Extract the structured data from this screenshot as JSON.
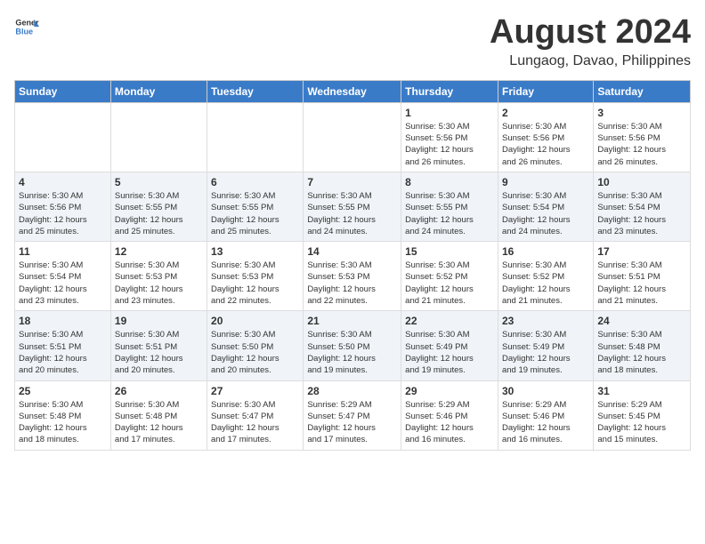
{
  "header": {
    "logo_general": "General",
    "logo_blue": "Blue",
    "title": "August 2024",
    "location": "Lungaog, Davao, Philippines"
  },
  "weekdays": [
    "Sunday",
    "Monday",
    "Tuesday",
    "Wednesday",
    "Thursday",
    "Friday",
    "Saturday"
  ],
  "weeks": [
    {
      "days": [
        {
          "num": "",
          "info": ""
        },
        {
          "num": "",
          "info": ""
        },
        {
          "num": "",
          "info": ""
        },
        {
          "num": "",
          "info": ""
        },
        {
          "num": "1",
          "info": "Sunrise: 5:30 AM\nSunset: 5:56 PM\nDaylight: 12 hours\nand 26 minutes."
        },
        {
          "num": "2",
          "info": "Sunrise: 5:30 AM\nSunset: 5:56 PM\nDaylight: 12 hours\nand 26 minutes."
        },
        {
          "num": "3",
          "info": "Sunrise: 5:30 AM\nSunset: 5:56 PM\nDaylight: 12 hours\nand 26 minutes."
        }
      ]
    },
    {
      "days": [
        {
          "num": "4",
          "info": "Sunrise: 5:30 AM\nSunset: 5:56 PM\nDaylight: 12 hours\nand 25 minutes."
        },
        {
          "num": "5",
          "info": "Sunrise: 5:30 AM\nSunset: 5:55 PM\nDaylight: 12 hours\nand 25 minutes."
        },
        {
          "num": "6",
          "info": "Sunrise: 5:30 AM\nSunset: 5:55 PM\nDaylight: 12 hours\nand 25 minutes."
        },
        {
          "num": "7",
          "info": "Sunrise: 5:30 AM\nSunset: 5:55 PM\nDaylight: 12 hours\nand 24 minutes."
        },
        {
          "num": "8",
          "info": "Sunrise: 5:30 AM\nSunset: 5:55 PM\nDaylight: 12 hours\nand 24 minutes."
        },
        {
          "num": "9",
          "info": "Sunrise: 5:30 AM\nSunset: 5:54 PM\nDaylight: 12 hours\nand 24 minutes."
        },
        {
          "num": "10",
          "info": "Sunrise: 5:30 AM\nSunset: 5:54 PM\nDaylight: 12 hours\nand 23 minutes."
        }
      ]
    },
    {
      "days": [
        {
          "num": "11",
          "info": "Sunrise: 5:30 AM\nSunset: 5:54 PM\nDaylight: 12 hours\nand 23 minutes."
        },
        {
          "num": "12",
          "info": "Sunrise: 5:30 AM\nSunset: 5:53 PM\nDaylight: 12 hours\nand 23 minutes."
        },
        {
          "num": "13",
          "info": "Sunrise: 5:30 AM\nSunset: 5:53 PM\nDaylight: 12 hours\nand 22 minutes."
        },
        {
          "num": "14",
          "info": "Sunrise: 5:30 AM\nSunset: 5:53 PM\nDaylight: 12 hours\nand 22 minutes."
        },
        {
          "num": "15",
          "info": "Sunrise: 5:30 AM\nSunset: 5:52 PM\nDaylight: 12 hours\nand 21 minutes."
        },
        {
          "num": "16",
          "info": "Sunrise: 5:30 AM\nSunset: 5:52 PM\nDaylight: 12 hours\nand 21 minutes."
        },
        {
          "num": "17",
          "info": "Sunrise: 5:30 AM\nSunset: 5:51 PM\nDaylight: 12 hours\nand 21 minutes."
        }
      ]
    },
    {
      "days": [
        {
          "num": "18",
          "info": "Sunrise: 5:30 AM\nSunset: 5:51 PM\nDaylight: 12 hours\nand 20 minutes."
        },
        {
          "num": "19",
          "info": "Sunrise: 5:30 AM\nSunset: 5:51 PM\nDaylight: 12 hours\nand 20 minutes."
        },
        {
          "num": "20",
          "info": "Sunrise: 5:30 AM\nSunset: 5:50 PM\nDaylight: 12 hours\nand 20 minutes."
        },
        {
          "num": "21",
          "info": "Sunrise: 5:30 AM\nSunset: 5:50 PM\nDaylight: 12 hours\nand 19 minutes."
        },
        {
          "num": "22",
          "info": "Sunrise: 5:30 AM\nSunset: 5:49 PM\nDaylight: 12 hours\nand 19 minutes."
        },
        {
          "num": "23",
          "info": "Sunrise: 5:30 AM\nSunset: 5:49 PM\nDaylight: 12 hours\nand 19 minutes."
        },
        {
          "num": "24",
          "info": "Sunrise: 5:30 AM\nSunset: 5:48 PM\nDaylight: 12 hours\nand 18 minutes."
        }
      ]
    },
    {
      "days": [
        {
          "num": "25",
          "info": "Sunrise: 5:30 AM\nSunset: 5:48 PM\nDaylight: 12 hours\nand 18 minutes."
        },
        {
          "num": "26",
          "info": "Sunrise: 5:30 AM\nSunset: 5:48 PM\nDaylight: 12 hours\nand 17 minutes."
        },
        {
          "num": "27",
          "info": "Sunrise: 5:30 AM\nSunset: 5:47 PM\nDaylight: 12 hours\nand 17 minutes."
        },
        {
          "num": "28",
          "info": "Sunrise: 5:29 AM\nSunset: 5:47 PM\nDaylight: 12 hours\nand 17 minutes."
        },
        {
          "num": "29",
          "info": "Sunrise: 5:29 AM\nSunset: 5:46 PM\nDaylight: 12 hours\nand 16 minutes."
        },
        {
          "num": "30",
          "info": "Sunrise: 5:29 AM\nSunset: 5:46 PM\nDaylight: 12 hours\nand 16 minutes."
        },
        {
          "num": "31",
          "info": "Sunrise: 5:29 AM\nSunset: 5:45 PM\nDaylight: 12 hours\nand 15 minutes."
        }
      ]
    }
  ]
}
